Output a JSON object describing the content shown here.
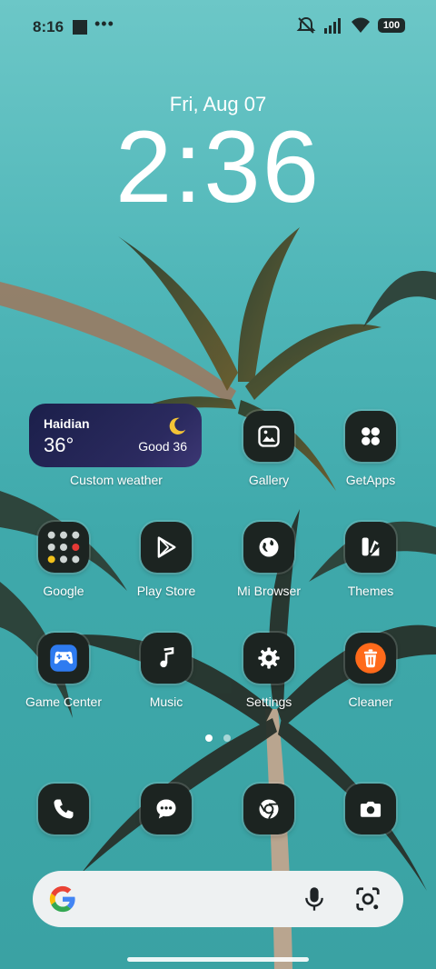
{
  "status": {
    "time": "8:16",
    "battery": "100"
  },
  "lock": {
    "date": "Fri, Aug 07",
    "clock": "2:36"
  },
  "weather": {
    "city": "Haidian",
    "temp": "36°",
    "aqi": "Good 36",
    "label": "Custom weather"
  },
  "apps": {
    "gallery": "Gallery",
    "getapps": "GetApps",
    "google": "Google",
    "playstore": "Play Store",
    "browser": "Mi Browser",
    "themes": "Themes",
    "gamecenter": "Game Center",
    "music": "Music",
    "settings": "Settings",
    "cleaner": "Cleaner"
  },
  "colors": {
    "accent": "#ff6a1a",
    "icon_bg": "#1c2421",
    "weather_bg": "#1b1f4a"
  }
}
